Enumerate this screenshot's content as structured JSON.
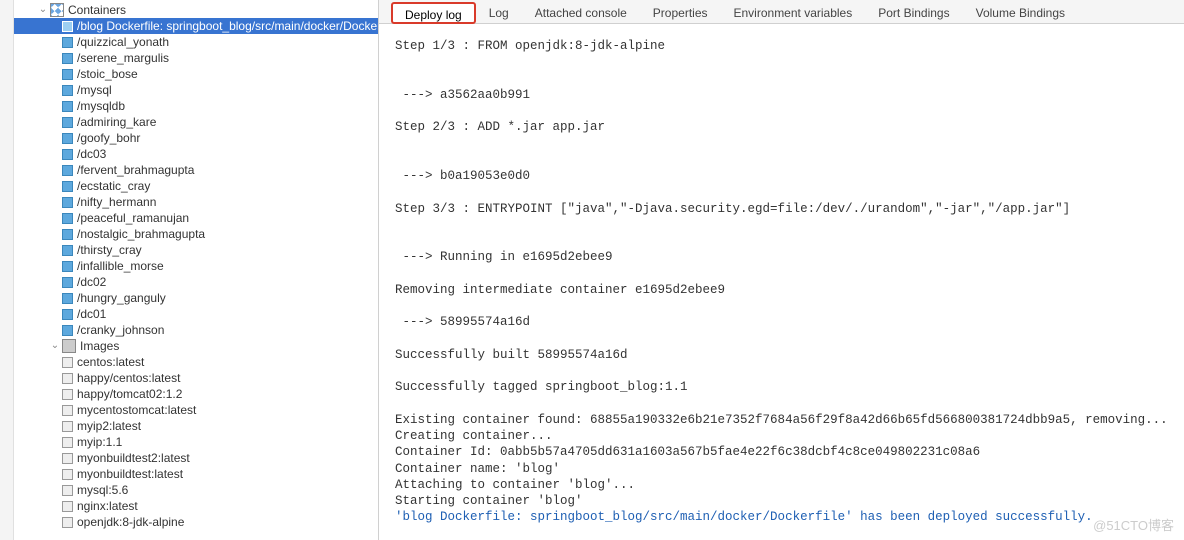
{
  "sidebar": {
    "containers_label": "Containers",
    "selected": "/blog Dockerfile: springboot_blog/src/main/docker/Dockerfile",
    "containers": [
      "/quizzical_yonath",
      "/serene_margulis",
      "/stoic_bose",
      "/mysql",
      "/mysqldb",
      "/admiring_kare",
      "/goofy_bohr",
      "/dc03",
      "/fervent_brahmagupta",
      "/ecstatic_cray",
      "/nifty_hermann",
      "/peaceful_ramanujan",
      "/nostalgic_brahmagupta",
      "/thirsty_cray",
      "/infallible_morse",
      "/dc02",
      "/hungry_ganguly",
      "/dc01",
      "/cranky_johnson"
    ],
    "images_label": "Images",
    "images": [
      "centos:latest",
      "happy/centos:latest",
      "happy/tomcat02:1.2",
      "mycentostomcat:latest",
      "myip2:latest",
      "myip:1.1",
      "myonbuildtest2:latest",
      "myonbuildtest:latest",
      "mysql:5.6",
      "nginx:latest",
      "openjdk:8-jdk-alpine"
    ]
  },
  "tabs": {
    "active": "Deploy log",
    "items": [
      "Deploy log",
      "Log",
      "Attached console",
      "Properties",
      "Environment variables",
      "Port Bindings",
      "Volume Bindings"
    ]
  },
  "log": {
    "lines": [
      "Step 1/3 : FROM openjdk:8-jdk-alpine",
      "",
      "",
      " ---> a3562aa0b991",
      "",
      "Step 2/3 : ADD *.jar app.jar",
      "",
      "",
      " ---> b0a19053e0d0",
      "",
      "Step 3/3 : ENTRYPOINT [\"java\",\"-Djava.security.egd=file:/dev/./urandom\",\"-jar\",\"/app.jar\"]",
      "",
      "",
      " ---> Running in e1695d2ebee9",
      "",
      "Removing intermediate container e1695d2ebee9",
      "",
      " ---> 58995574a16d",
      "",
      "Successfully built 58995574a16d",
      "",
      "Successfully tagged springboot_blog:1.1",
      "",
      "Existing container found: 68855a190332e6b21e7352f7684a56f29f8a42d66b65fd566800381724dbb9a5, removing...",
      "Creating container...",
      "Container Id: 0abb5b57a4705dd631a1603a567b5fae4e22f6c38dcbf4c8ce049802231c08a6",
      "Container name: 'blog'",
      "Attaching to container 'blog'...",
      "Starting container 'blog'"
    ],
    "success": "'blog Dockerfile: springboot_blog/src/main/docker/Dockerfile' has been deployed successfully."
  },
  "watermark": "@51CTO博客"
}
